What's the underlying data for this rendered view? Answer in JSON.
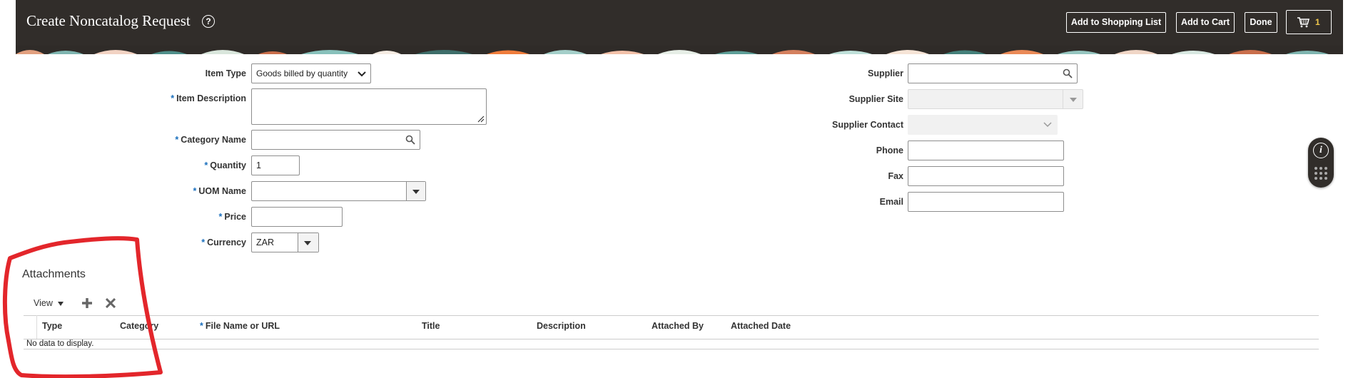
{
  "header": {
    "title": "Create Noncatalog Request",
    "buttons": {
      "add_to_shopping_list": "Add to Shopping List",
      "add_to_cart": "Add to Cart",
      "done": "Done"
    },
    "cart_count": "1"
  },
  "form_left": {
    "item_type": {
      "label": "Item Type",
      "value": "Goods billed by quantity"
    },
    "item_description": {
      "label": "Item Description",
      "value": ""
    },
    "category_name": {
      "label": "Category Name",
      "value": ""
    },
    "quantity": {
      "label": "Quantity",
      "value": "1"
    },
    "uom_name": {
      "label": "UOM Name",
      "value": ""
    },
    "price": {
      "label": "Price",
      "value": ""
    },
    "currency": {
      "label": "Currency",
      "value": "ZAR"
    }
  },
  "form_right": {
    "supplier": {
      "label": "Supplier",
      "value": ""
    },
    "supplier_site": {
      "label": "Supplier Site",
      "value": ""
    },
    "supplier_contact": {
      "label": "Supplier Contact",
      "value": ""
    },
    "phone": {
      "label": "Phone",
      "value": ""
    },
    "fax": {
      "label": "Fax",
      "value": ""
    },
    "email": {
      "label": "Email",
      "value": ""
    }
  },
  "attachments": {
    "title": "Attachments",
    "view_menu": "View",
    "columns": [
      "Type",
      "Category",
      "File Name or URL",
      "Title",
      "Description",
      "Attached By",
      "Attached Date"
    ],
    "empty_text": "No data to display."
  },
  "colors": {
    "header_bg": "#312d2a",
    "required_marker": "#1a6fbd",
    "annotation_red": "#e3262b"
  },
  "icons": [
    "help-icon",
    "cart-icon",
    "search-icon",
    "chevron-down-icon",
    "add-icon",
    "delete-icon",
    "info-icon",
    "keypad-icon"
  ]
}
